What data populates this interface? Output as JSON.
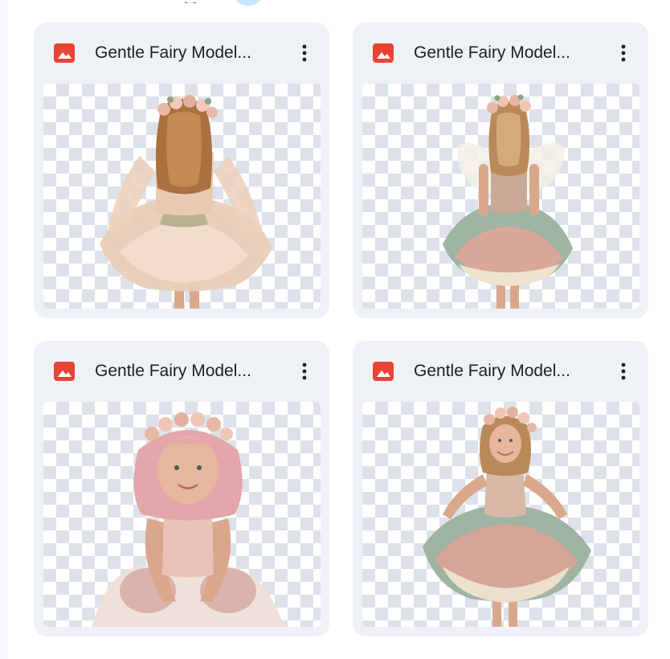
{
  "files": [
    {
      "title": "Gentle Fairy Model...",
      "type_icon": "image-file-icon",
      "menu_icon": "more-vert-icon",
      "thumbnail": "girl-back-view-curly-hair-flower-crown-tulle-dress"
    },
    {
      "title": "Gentle Fairy Model...",
      "type_icon": "image-file-icon",
      "menu_icon": "more-vert-icon",
      "thumbnail": "girl-back-view-fairy-wings-green-pink-tutu"
    },
    {
      "title": "Gentle Fairy Model...",
      "type_icon": "image-file-icon",
      "menu_icon": "more-vert-icon",
      "thumbnail": "girl-pink-hair-flower-crown-sitting"
    },
    {
      "title": "Gentle Fairy Model...",
      "type_icon": "image-file-icon",
      "menu_icon": "more-vert-icon",
      "thumbnail": "girl-smiling-flower-crown-pastel-tutu"
    }
  ],
  "colors": {
    "card_background": "#eef2f7",
    "file_icon": "#ea4335",
    "title_text": "#1f1f1f",
    "accent": "#c2e7ff"
  }
}
